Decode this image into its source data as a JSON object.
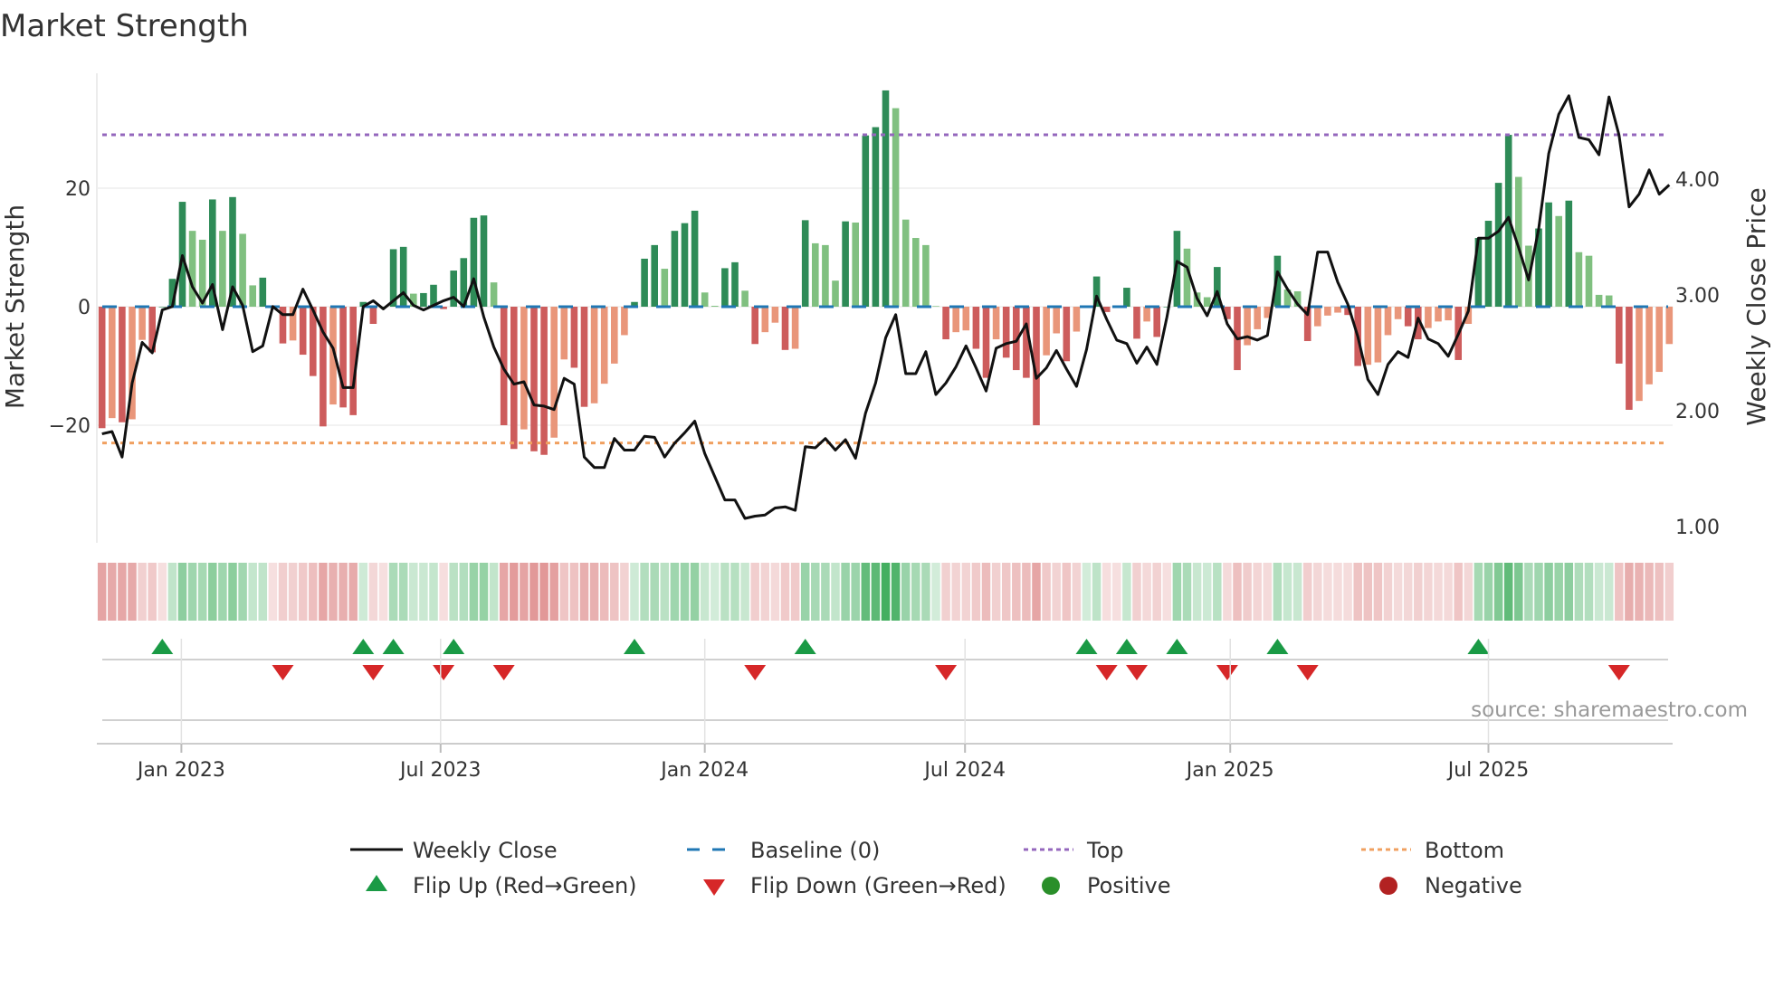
{
  "title": "Market Strength",
  "source": "source: sharemaestro.com",
  "colors": {
    "bar_pos_strong": "#2e8b57",
    "bar_pos_weak": "#80c080",
    "bar_neg_strong": "#cd5c5c",
    "bar_neg_weak": "#e9967a",
    "price_line": "#111111",
    "baseline": "#1f77b4",
    "top": "#9467bd",
    "bottom": "#f0a060",
    "flip_up": "#1a9a45",
    "flip_down": "#d62728",
    "positive": "#2ca02c",
    "negative": "#b22222"
  },
  "legend": {
    "weekly_close": "Weekly Close",
    "baseline": "Baseline (0)",
    "top": "Top",
    "bottom": "Bottom",
    "flip_up": "Flip Up (Red→Green)",
    "flip_down": "Flip Down (Green→Red)",
    "positive": "Positive",
    "negative": "Negative"
  },
  "chart_data": {
    "type": "bar",
    "title": "Market Strength",
    "ylabel": "Market Strength",
    "y2label": "Weekly Close Price",
    "ylim": [
      -40,
      40
    ],
    "y2lim": [
      0.86,
      4.91
    ],
    "yticks": [
      {
        "v": 20,
        "label": "20"
      },
      {
        "v": 0,
        "label": "0"
      },
      {
        "v": -20,
        "label": "−20"
      }
    ],
    "y2ticks": [
      {
        "v": 4,
        "label": "4.00"
      },
      {
        "v": 3,
        "label": "3.00"
      },
      {
        "v": 2,
        "label": "2.00"
      },
      {
        "v": 1,
        "label": "1.00"
      }
    ],
    "x_ticks": [
      {
        "week": 7.9,
        "label": "Jan 2023"
      },
      {
        "week": 33.7,
        "label": "Jul 2023"
      },
      {
        "week": 60.0,
        "label": "Jan 2024"
      },
      {
        "week": 85.9,
        "label": "Jul 2024"
      },
      {
        "week": 112.3,
        "label": "Jan 2025"
      },
      {
        "week": 138.0,
        "label": "Jul 2025"
      }
    ],
    "top_level": 29,
    "bottom_level": -23,
    "baseline": 0,
    "strength": [
      -20.5,
      -18.8,
      -19.5,
      -19,
      -5.6,
      -7.7,
      0,
      4.7,
      17.7,
      12.8,
      11.3,
      18.1,
      12.8,
      18.5,
      12.3,
      3.6,
      4.9,
      0,
      -6.2,
      -5.7,
      -8.1,
      -11.7,
      -20.2,
      -16.5,
      -17,
      -18.3,
      0.8,
      -2.9,
      0,
      9.7,
      10.1,
      2.2,
      2.3,
      3.7,
      -0.4,
      6.1,
      8.2,
      15,
      15.4,
      4.1,
      -20,
      -24,
      -20.7,
      -24.4,
      -25,
      -22.1,
      -8.9,
      -10.3,
      -16.9,
      -16.3,
      -13,
      -9.6,
      -4.8,
      0.8,
      8.1,
      10.4,
      6.4,
      12.8,
      14.1,
      16.2,
      2.4,
      0.15,
      6.5,
      7.5,
      2.7,
      -6.3,
      -4.3,
      -2.7,
      -7.3,
      -7.1,
      14.6,
      10.7,
      10.4,
      4.4,
      14.4,
      14.2,
      28.9,
      30.3,
      36.5,
      33.5,
      14.7,
      11.6,
      10.4,
      0.1,
      -5.5,
      -4.3,
      -4,
      -7.1,
      -12,
      -5.5,
      -8.6,
      -10.7,
      -12,
      -20,
      -8.2,
      -4.5,
      -9.2,
      -4.2,
      0.1,
      5.1,
      -0.9,
      0,
      3.2,
      -5.4,
      -2.5,
      -5.1,
      0,
      12.8,
      9.8,
      2.4,
      1.6,
      6.7,
      -2.1,
      -10.7,
      -6.5,
      -3.8,
      -1.9,
      8.6,
      2.9,
      2.6,
      -5.8,
      -3.3,
      -1.5,
      -1,
      -1.4,
      -10,
      -9.8,
      -9.4,
      -4.8,
      -2.1,
      -3.3,
      -5.5,
      -3.6,
      -2.5,
      -2.3,
      -9,
      -2.9,
      11.6,
      14.5,
      20.9,
      29,
      21.9,
      10.3,
      13.2,
      17.6,
      15.3,
      17.9,
      9.2,
      8.6,
      2,
      1.9,
      -9.6,
      -17.4,
      -15.9,
      -13.1,
      -11,
      -6.3
    ],
    "weekly_close": [
      1.8,
      1.82,
      1.6,
      2.24,
      2.59,
      2.5,
      2.87,
      2.9,
      3.34,
      3.07,
      2.93,
      3.09,
      2.7,
      3.07,
      2.91,
      2.51,
      2.56,
      2.9,
      2.83,
      2.83,
      3.05,
      2.87,
      2.68,
      2.54,
      2.2,
      2.2,
      2.9,
      2.95,
      2.88,
      2.95,
      3.02,
      2.91,
      2.87,
      2.91,
      2.95,
      2.98,
      2.9,
      3.14,
      2.81,
      2.55,
      2.36,
      2.23,
      2.25,
      2.05,
      2.04,
      2.01,
      2.28,
      2.23,
      1.6,
      1.51,
      1.51,
      1.76,
      1.66,
      1.66,
      1.78,
      1.77,
      1.6,
      1.72,
      1.81,
      1.91,
      1.63,
      1.43,
      1.23,
      1.23,
      1.07,
      1.09,
      1.1,
      1.16,
      1.17,
      1.14,
      1.69,
      1.68,
      1.76,
      1.66,
      1.75,
      1.59,
      1.98,
      2.24,
      2.63,
      2.83,
      2.32,
      2.32,
      2.51,
      2.14,
      2.24,
      2.38,
      2.56,
      2.37,
      2.17,
      2.54,
      2.58,
      2.6,
      2.75,
      2.28,
      2.37,
      2.52,
      2.36,
      2.21,
      2.53,
      2.99,
      2.79,
      2.61,
      2.58,
      2.41,
      2.55,
      2.4,
      2.81,
      3.29,
      3.24,
      2.97,
      2.82,
      3.03,
      2.75,
      2.62,
      2.64,
      2.61,
      2.65,
      3.2,
      3.05,
      2.92,
      2.83,
      3.37,
      3.37,
      3.11,
      2.92,
      2.64,
      2.27,
      2.14,
      2.4,
      2.51,
      2.46,
      2.8,
      2.62,
      2.58,
      2.47,
      2.66,
      2.86,
      3.49,
      3.49,
      3.55,
      3.67,
      3.41,
      3.13,
      3.57,
      4.22,
      4.56,
      4.72,
      4.36,
      4.34,
      4.21,
      4.71,
      4.38,
      3.76,
      3.87,
      4.08,
      3.87,
      3.95
    ],
    "flip_up_weeks": [
      7,
      27,
      30,
      36,
      54,
      71,
      99,
      103,
      108,
      118,
      138
    ],
    "flip_down_weeks": [
      19,
      28,
      35,
      41,
      66,
      85,
      101,
      104,
      113,
      121,
      152
    ]
  }
}
